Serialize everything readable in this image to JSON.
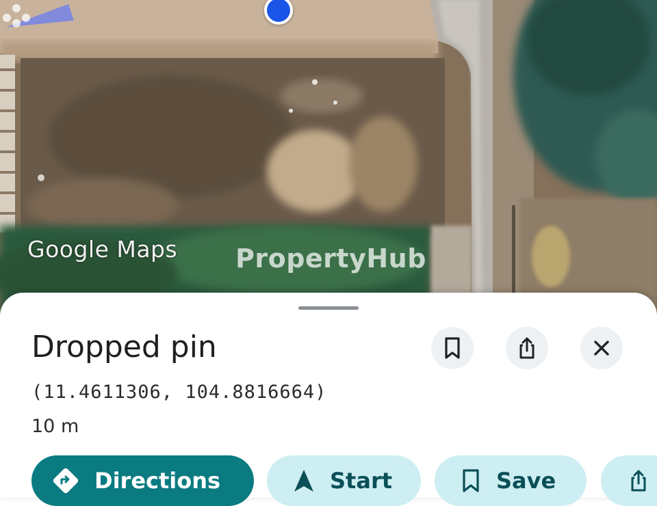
{
  "map": {
    "logo_text": "Google Maps",
    "watermark_text": "PropertyHub"
  },
  "place": {
    "title": "Dropped pin",
    "coordinates": "(11.4611306, 104.8816664)",
    "distance": "10 m"
  },
  "header_actions": {
    "bookmark_icon": "bookmark-icon",
    "share_icon": "share-icon",
    "close_icon": "close-icon"
  },
  "actions": [
    {
      "label": "Directions",
      "icon": "directions-icon"
    },
    {
      "label": "Start",
      "icon": "navigation-arrow-icon"
    },
    {
      "label": "Save",
      "icon": "bookmark-icon"
    },
    {
      "label": "",
      "icon": "share-icon"
    }
  ],
  "colors": {
    "primary_chip": "#0a7b80",
    "secondary_chip": "#cdeef2",
    "location_dot": "#1a55e8"
  }
}
